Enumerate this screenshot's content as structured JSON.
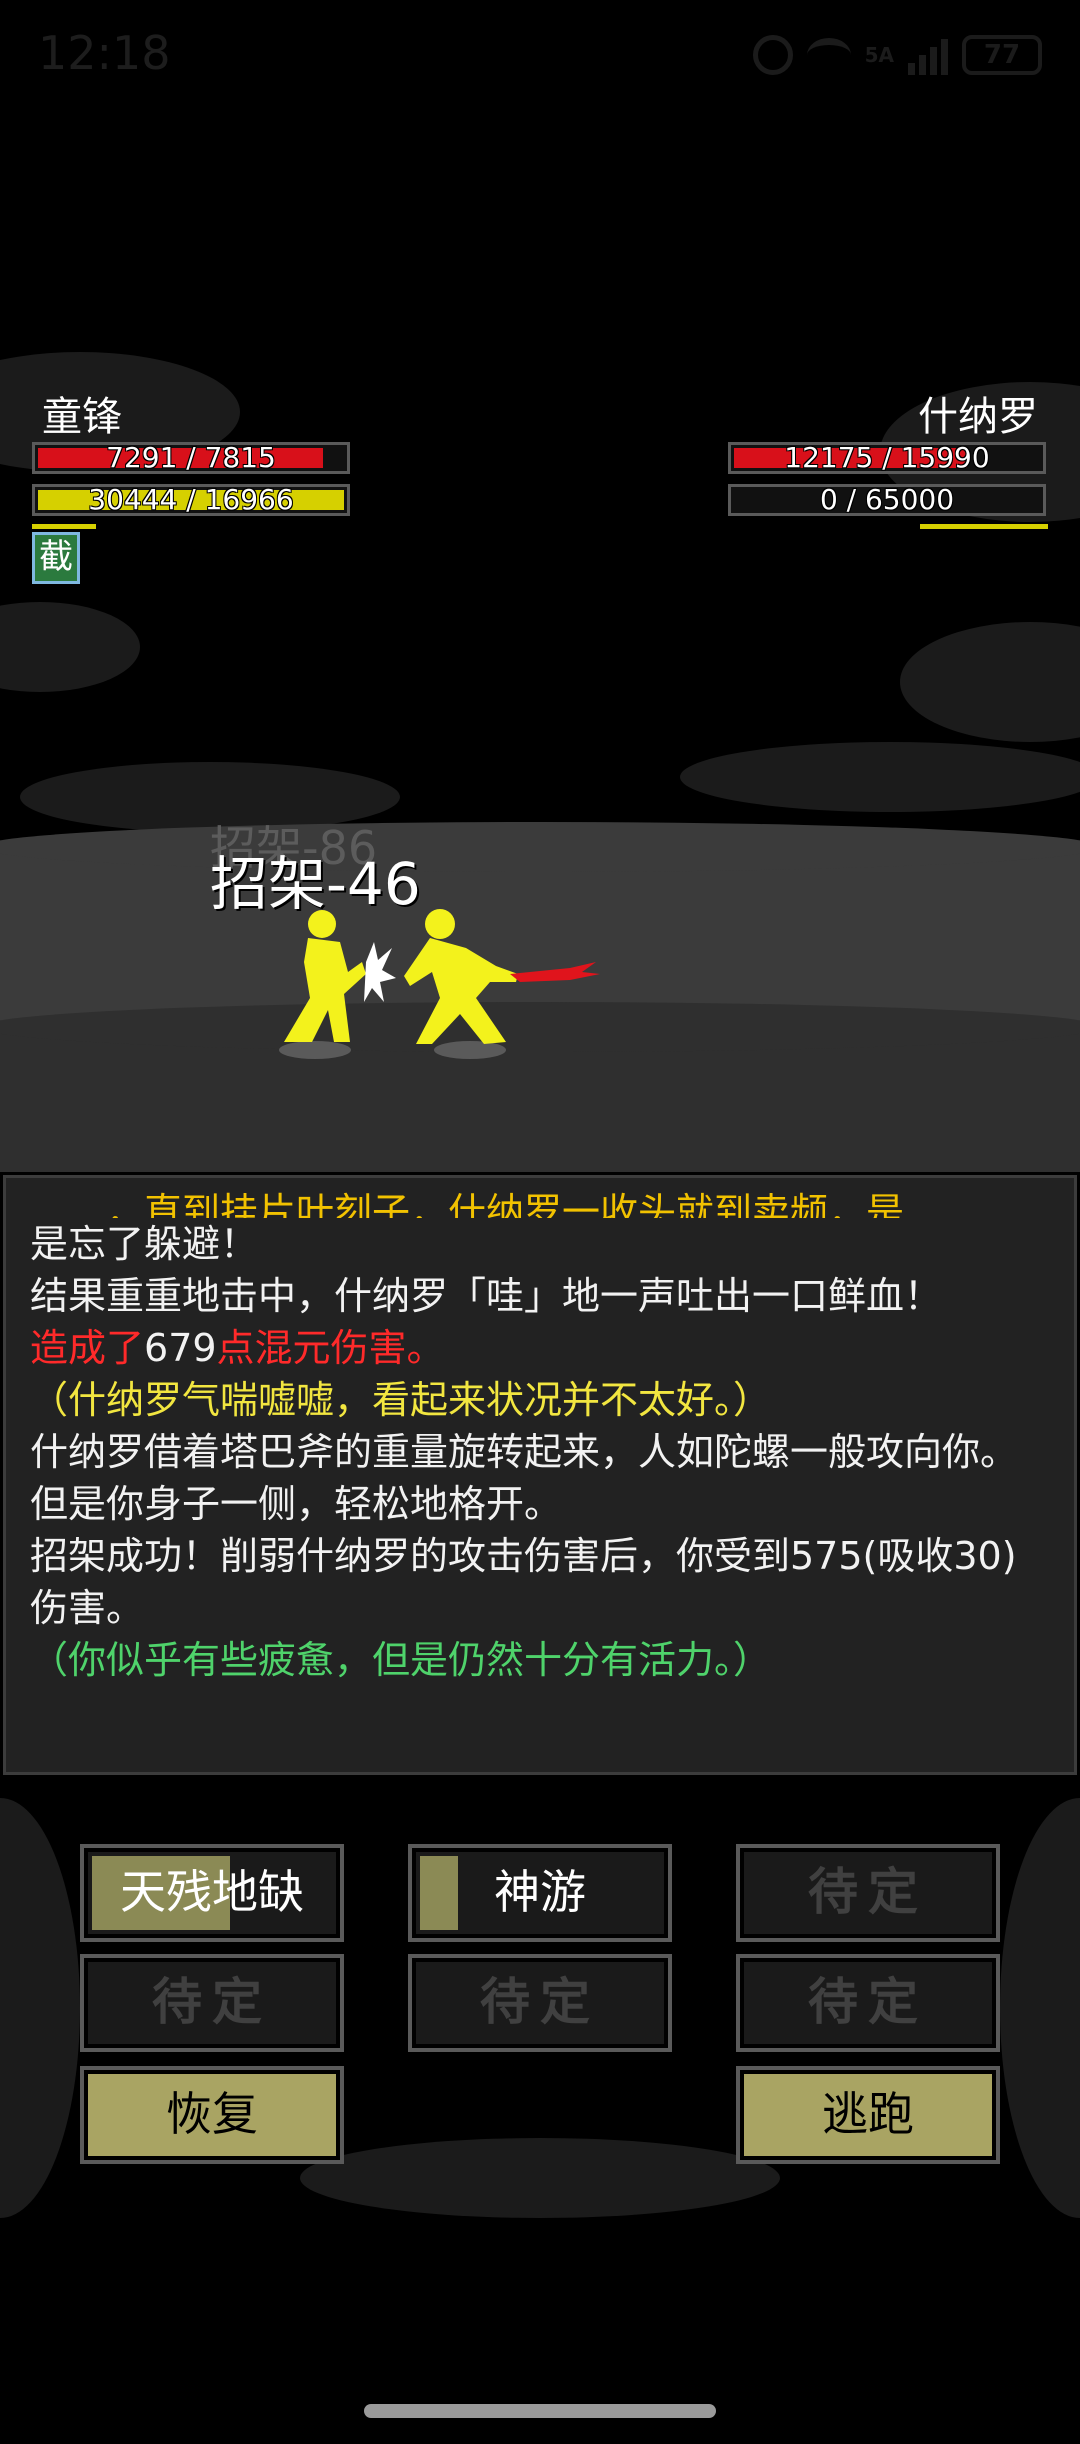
{
  "status_bar": {
    "time": "12:18",
    "network": "5A",
    "battery": "77"
  },
  "player": {
    "name": "童锋",
    "hp": "7291 / 7815",
    "hp_fraction": 0.93,
    "mp": "30444 / 16966",
    "mp_fraction": 1.0,
    "buff": "截"
  },
  "enemy": {
    "name": "什纳罗",
    "hp": "12175 / 15990",
    "hp_fraction": 0.76,
    "mp": "0 / 65000",
    "mp_fraction": 0.0
  },
  "floating_text": {
    "previous": "招架-86",
    "current": "招架-46"
  },
  "log": {
    "cut_line": "……，直到挂片叶刻子，什纳罗一收头就到卖频，是",
    "line1": "是忘了躲避！",
    "line2": "结果重重地击中，什纳罗「哇」地一声吐出一口鲜血！",
    "line3_a": "造成了",
    "line3_b": "679",
    "line3_c": "点混元伤害。",
    "line4": "（什纳罗气喘嘘嘘，看起来状况并不太好。）",
    "line5": "什纳罗借着塔巴斧的重量旋转起来，人如陀螺一般攻向你。",
    "line6": "但是你身子一侧，轻松地格开。",
    "line7": "招架成功！削弱什纳罗的攻击伤害后，你受到575(吸收30)伤害。",
    "line8": "（你似乎有些疲惫，但是仍然十分有活力。）"
  },
  "actions": {
    "skill1": "天残地缺",
    "skill1_progress": 0.55,
    "skill2": "神游",
    "skill2_progress": 0.15,
    "slot_empty": "待定",
    "recover": "恢复",
    "escape": "逃跑"
  },
  "colors": {
    "hp_red": "#d8101a",
    "mp_yellow": "#d6d000",
    "log_red": "#ff2a2a",
    "log_yellow": "#f2e640",
    "log_green": "#4fd36b",
    "button_olive": "#a9a463"
  }
}
